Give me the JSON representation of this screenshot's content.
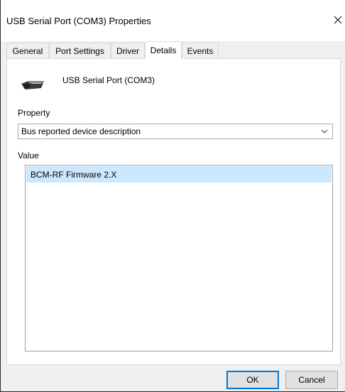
{
  "window": {
    "title": "USB Serial Port (COM3) Properties"
  },
  "tabs": [
    {
      "label": "General",
      "active": false
    },
    {
      "label": "Port Settings",
      "active": false
    },
    {
      "label": "Driver",
      "active": false
    },
    {
      "label": "Details",
      "active": true
    },
    {
      "label": "Events",
      "active": false
    }
  ],
  "details": {
    "device_name": "USB Serial Port (COM3)",
    "device_icon": "serial-port-connector-icon",
    "property_label": "Property",
    "property_selected": "Bus reported device description",
    "value_label": "Value",
    "values": [
      "BCM-RF Firmware 2.X"
    ]
  },
  "buttons": {
    "ok": "OK",
    "cancel": "Cancel"
  },
  "colors": {
    "selection": "#cce8ff",
    "focus_border": "#0078d7"
  }
}
